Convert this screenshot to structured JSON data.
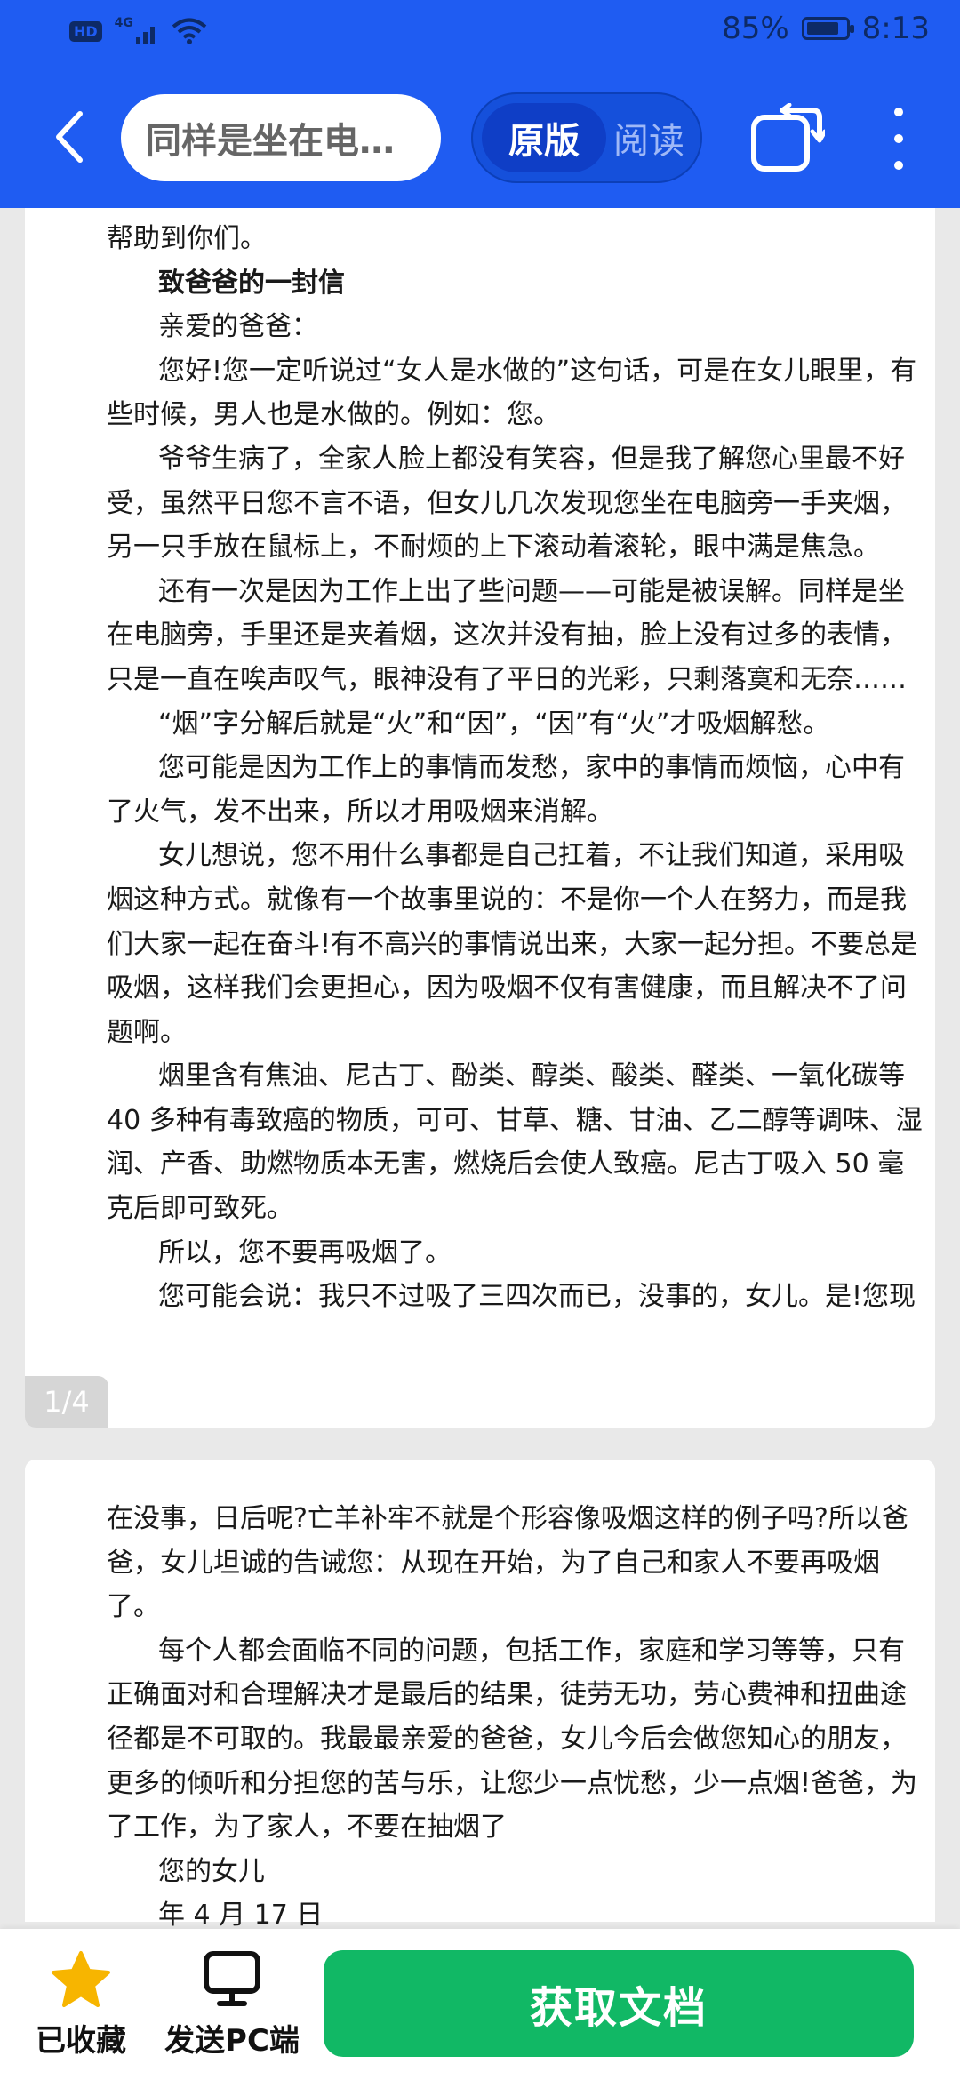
{
  "status": {
    "hd": "HD",
    "network": "4G",
    "battery_pct": "85%",
    "battery_level": 0.85,
    "time": "8:13"
  },
  "header": {
    "title": "同样是坐在电脑旁，手里还是夹着烟",
    "seg_original": "原版",
    "seg_read": "阅读"
  },
  "page1": {
    "paragraphs": [
      {
        "text": "帮助到你们。",
        "indent": false,
        "bold": false
      },
      {
        "text": "致爸爸的一封信",
        "indent": true,
        "bold": true
      },
      {
        "text": "亲爱的爸爸：",
        "indent": true,
        "bold": false
      },
      {
        "text": "您好!您一定听说过“女人是水做的”这句话，可是在女儿眼里，有些时候，男人也是水做的。例如：您。",
        "indent": true,
        "bold": false
      },
      {
        "text": "爷爷生病了，全家人脸上都没有笑容，但是我了解您心里最不好受，虽然平日您不言不语，但女儿几次发现您坐在电脑旁一手夹烟，另一只手放在鼠标上，不耐烦的上下滚动着滚轮，眼中满是焦急。",
        "indent": true,
        "bold": false
      },
      {
        "text": "还有一次是因为工作上出了些问题——可能是被误解。同样是坐在电脑旁，手里还是夹着烟，这次并没有抽，脸上没有过多的表情，只是一直在唉声叹气，眼神没有了平日的光彩，只剩落寞和无奈……",
        "indent": true,
        "bold": false
      },
      {
        "text": "“烟”字分解后就是“火”和“因”，“因”有“火”才吸烟解愁。",
        "indent": true,
        "bold": false
      },
      {
        "text": "您可能是因为工作上的事情而发愁，家中的事情而烦恼，心中有了火气，发不出来，所以才用吸烟来消解。",
        "indent": true,
        "bold": false
      },
      {
        "text": "女儿想说，您不用什么事都是自己扛着，不让我们知道，采用吸烟这种方式。就像有一个故事里说的：不是你一个人在努力，而是我们大家一起在奋斗!有不高兴的事情说出来，大家一起分担。不要总是吸烟，这样我们会更担心，因为吸烟不仅有害健康，而且解决不了问题啊。",
        "indent": true,
        "bold": false
      },
      {
        "text": "烟里含有焦油、尼古丁、酚类、醇类、酸类、醛类、一氧化碳等 40 多种有毒致癌的物质，可可、甘草、糖、甘油、乙二醇等调味、湿润、产香、助燃物质本无害，燃烧后会使人致癌。尼古丁吸入 50 毫克后即可致死。",
        "indent": true,
        "bold": false
      },
      {
        "text": "所以，您不要再吸烟了。",
        "indent": true,
        "bold": false
      },
      {
        "text": "您可能会说：我只不过吸了三四次而已，没事的，女儿。是!您现",
        "indent": true,
        "bold": false
      }
    ],
    "page_indicator": "1/4"
  },
  "page2": {
    "paragraphs": [
      {
        "text": "在没事，日后呢?亡羊补牢不就是个形容像吸烟这样的例子吗?所以爸爸，女儿坦诚的告诫您：从现在开始，为了自己和家人不要再吸烟了。",
        "indent": false,
        "bold": false
      },
      {
        "text": "每个人都会面临不同的问题，包括工作，家庭和学习等等，只有正确面对和合理解决才是最后的结果，徒劳无功，劳心费神和扭曲途径都是不可取的。我最最亲爱的爸爸，女儿今后会做您知心的朋友，更多的倾听和分担您的苦与乐，让您少一点忧愁，少一点烟!爸爸，为了工作，为了家人，不要在抽烟了",
        "indent": true,
        "bold": false
      },
      {
        "text": "您的女儿",
        "indent": true,
        "bold": false
      },
      {
        "text": "年 4 月 17 日",
        "indent": true,
        "bold": false
      }
    ]
  },
  "bottom": {
    "favorite_label": "已收藏",
    "send_pc_label": "发送PC端",
    "get_doc_label": "获取文档"
  },
  "colors": {
    "header_blue": "#1f5cf2",
    "button_green": "#11b865",
    "star_yellow": "#f7b500"
  }
}
